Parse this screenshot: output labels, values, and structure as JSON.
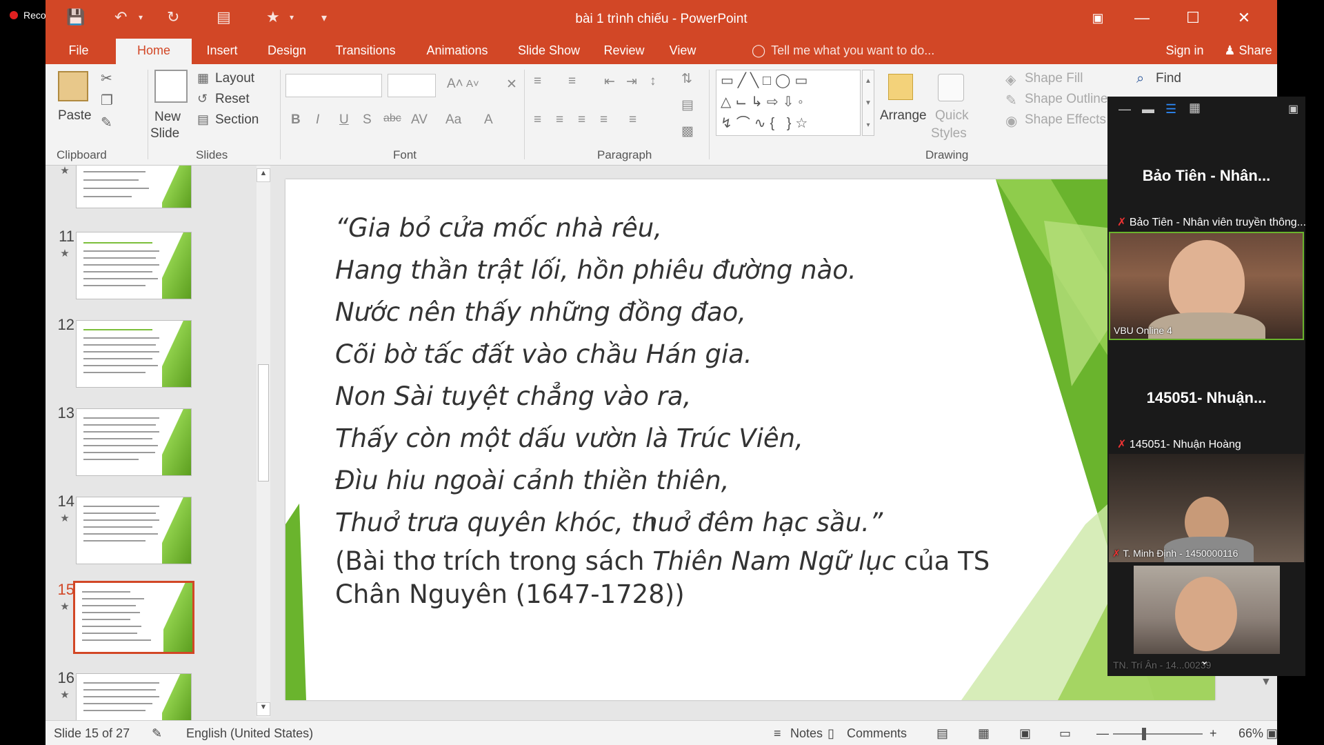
{
  "recording": {
    "label": "Recording"
  },
  "window": {
    "title": "bài 1 trình chiếu - PowerPoint"
  },
  "tabs": [
    "File",
    "Home",
    "Insert",
    "Design",
    "Transitions",
    "Animations",
    "Slide Show",
    "Review",
    "View"
  ],
  "tell_me": "Tell me what you want to do...",
  "sign_in": "Sign in",
  "share": "Share",
  "ribbon": {
    "clipboard": {
      "label": "Clipboard",
      "paste": "Paste"
    },
    "slides": {
      "label": "Slides",
      "new_slide_1": "New",
      "new_slide_2": "Slide",
      "layout": "Layout",
      "reset": "Reset",
      "section": "Section"
    },
    "font": {
      "label": "Font"
    },
    "paragraph": {
      "label": "Paragraph"
    },
    "drawing": {
      "label": "Drawing",
      "arrange": "Arrange",
      "quick_1": "Quick",
      "quick_2": "Styles",
      "shape_fill": "Shape Fill",
      "shape_outline": "Shape Outline",
      "shape_effects": "Shape Effects"
    },
    "editing": {
      "find": "Find"
    }
  },
  "thumbnails": [
    {
      "num": "11"
    },
    {
      "num": "12"
    },
    {
      "num": "13"
    },
    {
      "num": "14"
    },
    {
      "num": "15"
    },
    {
      "num": "16"
    }
  ],
  "slide": {
    "lines": [
      "“Gia bỏ cửa mốc nhà rêu,",
      "Hang thần trật lối, hồn phiêu đường nào.",
      "Nước nên thấy những đồng đao,",
      "Cõi bờ tấc đất vào chầu Hán gia.",
      "Non Sài tuyệt chẳng vào ra,",
      "Thấy còn một dấu vườn là Trúc Viên,",
      "Đìu hiu ngoài cảnh thiền thiên,",
      "Thuở trưa quyên khóc, thuở đêm hạc sầu.”"
    ],
    "source_pre": "(Bài thơ trích trong sách ",
    "source_book": "Thiên Nam Ngữ lục",
    "source_post": " của TS Chân Nguyên (1647-1728))"
  },
  "status": {
    "slide_info": "Slide 15 of 27",
    "language": "English (United States)",
    "notes": "Notes",
    "comments": "Comments",
    "zoom": "66%"
  },
  "zoom_panel": {
    "p1_big": "Bảo Tiên - Nhân...",
    "p1_small": "Bảo Tiên - Nhân viên truyền thông...",
    "p1_tile": "VBU Online 4",
    "p2_big": "145051- Nhuận...",
    "p2_small": "145051- Nhuận Hoàng",
    "p3_tile": "T. Minh Định - 1450000116",
    "p4_tile": "TN. Trí Ân - 14...00239"
  },
  "colors": {
    "accent": "#d24726",
    "green": "#6ab42d"
  }
}
